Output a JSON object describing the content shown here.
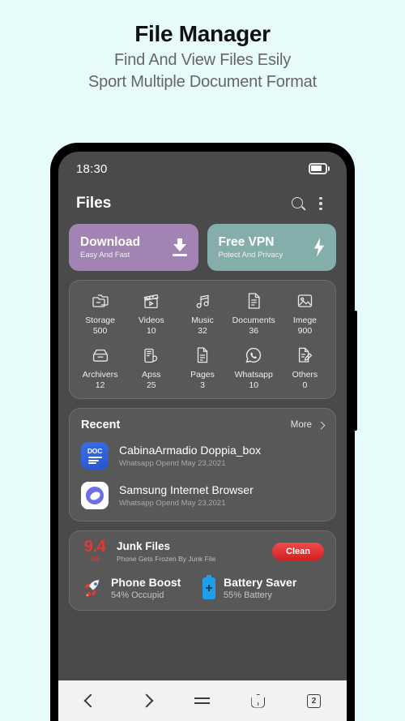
{
  "promo": {
    "title": "File Manager",
    "subtitle1": "Find And View Files Esily",
    "subtitle2": "Sport Multiple Document Format"
  },
  "status_bar": {
    "time": "18:30",
    "battery_icon": "battery-icon"
  },
  "app_bar": {
    "title": "Files",
    "search_icon": "search-icon",
    "overflow_icon": "more-vertical-icon"
  },
  "promo_cards": [
    {
      "title": "Download",
      "subtitle": "Easy And Fast",
      "color": "#a284b4",
      "icon": "download-icon"
    },
    {
      "title": "Free VPN",
      "subtitle": "Potect And Privacy",
      "color": "#83aeab",
      "icon": "lightning-bolt-icon"
    }
  ],
  "categories": {
    "row1": [
      {
        "name": "Storage",
        "count": "500",
        "icon": "folders-icon"
      },
      {
        "name": "Videos",
        "count": "10",
        "icon": "clapperboard-icon"
      },
      {
        "name": "Music",
        "count": "32",
        "icon": "music-note-icon"
      },
      {
        "name": "Documents",
        "count": "36",
        "icon": "document-icon"
      },
      {
        "name": "Imege",
        "count": "900",
        "icon": "image-icon"
      }
    ],
    "row2": [
      {
        "name": "Archivers",
        "count": "12",
        "icon": "archive-box-icon"
      },
      {
        "name": "Apss",
        "count": "25",
        "icon": "apps-phone-icon"
      },
      {
        "name": "Pages",
        "count": "3",
        "icon": "page-icon"
      },
      {
        "name": "Whatsapp",
        "count": "10",
        "icon": "whatsapp-icon"
      },
      {
        "name": "Others",
        "count": "0",
        "icon": "note-edit-icon"
      }
    ]
  },
  "recent": {
    "title": "Recent",
    "more_label": "More",
    "more_icon": "chevron-right-icon",
    "items": [
      {
        "name": "CabinaArmadio Doppia_box",
        "meta": "Whatsapp Opend May 23,2021",
        "icon": "doc-file-icon"
      },
      {
        "name": "Samsung Internet Browser",
        "meta": "Whatsapp Opend May 23,2021",
        "icon": "samsung-internet-icon"
      }
    ]
  },
  "junk": {
    "size_value": "9.4",
    "size_unit": "GB",
    "title": "Junk Files",
    "subtitle": "Phone Gets Frozen By Junk File",
    "clean_label": "Clean",
    "accent_color": "#e53935",
    "tools": [
      {
        "title": "Phone Boost",
        "value": "54% Occupid",
        "icon": "rocket-icon"
      },
      {
        "title": "Battery Saver",
        "value": "55% Battery",
        "icon": "battery-charge-icon"
      }
    ]
  },
  "nav_bar": {
    "back_icon": "chevron-left-icon",
    "forward_icon": "chevron-right-icon",
    "menu_icon": "hamburger-menu-icon",
    "home_icon": "home-icon",
    "tabs_icon": "tab-count-icon",
    "tabs_count": "2"
  }
}
